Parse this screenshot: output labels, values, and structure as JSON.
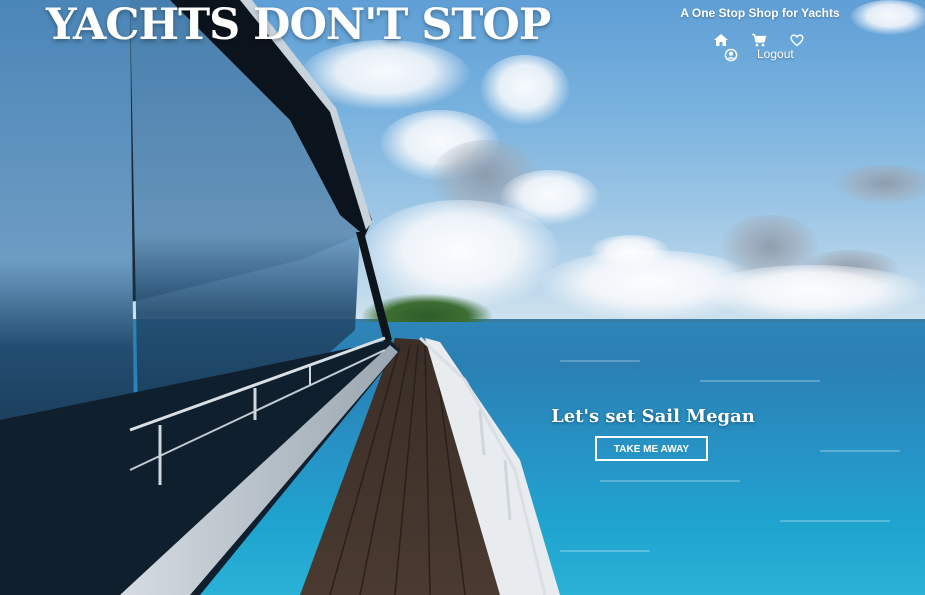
{
  "header": {
    "brand": "YACHTS DON'T STOP",
    "tagline": "A One Stop Shop for Yachts",
    "nav": {
      "home_icon": "home-icon",
      "cart_icon": "cart-icon",
      "wishlist_icon": "heart-icon",
      "account_icon": "user-circle-icon",
      "logout_label": "Logout"
    }
  },
  "hero": {
    "greeting": "Let's set Sail Megan",
    "cta_label": "TAKE ME AWAY"
  },
  "colors": {
    "text": "#ffffff",
    "sky": "#79b2de",
    "sea": "#2791c4"
  }
}
